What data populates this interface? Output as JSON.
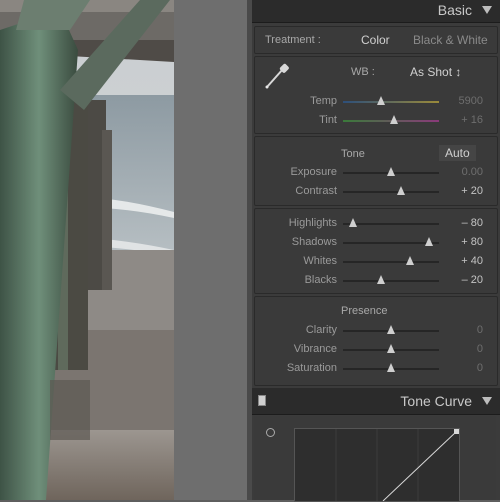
{
  "panel": {
    "title": "Basic",
    "treatment": {
      "label": "Treatment :",
      "options": [
        "Color",
        "Black & White"
      ],
      "selected": "Color"
    },
    "wb": {
      "label": "WB :",
      "value": "As Shot ↕"
    },
    "temp": [
      {
        "name": "Temp",
        "value": "5900",
        "level": 0.4,
        "dim": true
      },
      {
        "name": "Tint",
        "value": "+ 16",
        "level": 0.53,
        "dim": true
      }
    ],
    "tone": {
      "label": "Tone",
      "auto": "Auto"
    },
    "tone_rows": [
      {
        "name": "Exposure",
        "value": "0.00",
        "level": 0.5,
        "dim": true
      },
      {
        "name": "Contrast",
        "value": "+ 20",
        "level": 0.6,
        "dim": false
      }
    ],
    "tone_rows2": [
      {
        "name": "Highlights",
        "value": "– 80",
        "level": 0.1,
        "dim": false
      },
      {
        "name": "Shadows",
        "value": "+ 80",
        "level": 0.9,
        "dim": false
      },
      {
        "name": "Whites",
        "value": "+ 40",
        "level": 0.7,
        "dim": false
      },
      {
        "name": "Blacks",
        "value": "– 20",
        "level": 0.4,
        "dim": false
      }
    ],
    "presence": {
      "label": "Presence",
      "rows": [
        {
          "name": "Clarity",
          "value": "0",
          "level": 0.5,
          "dim": true
        },
        {
          "name": "Vibrance",
          "value": "0",
          "level": 0.5,
          "dim": true
        },
        {
          "name": "Saturation",
          "value": "0",
          "level": 0.5,
          "dim": true
        }
      ]
    }
  },
  "curve": {
    "title": "Tone Curve"
  },
  "icons": {
    "eyedropper": "eyedropper-icon",
    "collapse": "triangle-down-icon",
    "target": "target-adjust-icon"
  }
}
